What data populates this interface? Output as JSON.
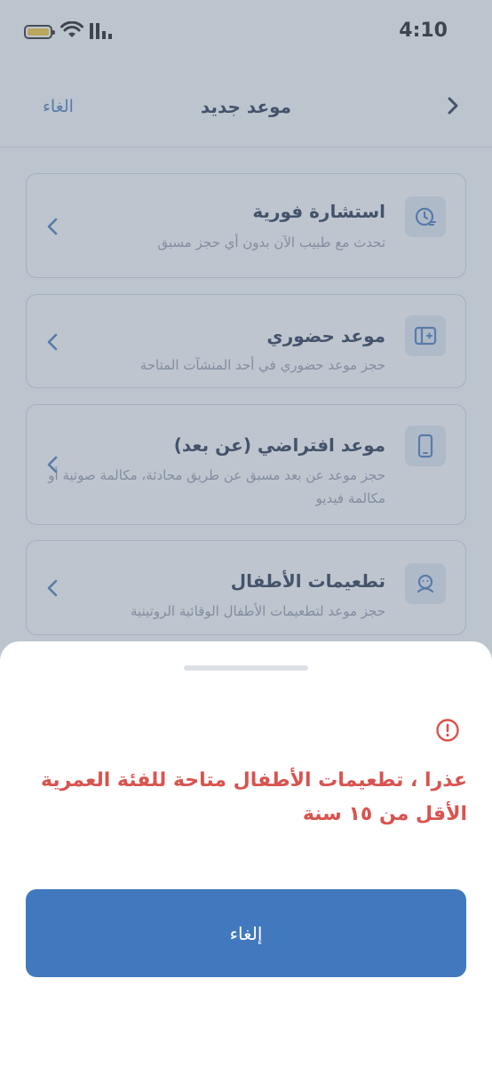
{
  "status_bar": {
    "time": "4:10"
  },
  "header": {
    "title": "موعد جديد",
    "cancel_label": "الغاء"
  },
  "options": [
    {
      "title": "استشارة فورية",
      "description": "تحدث مع طبيب الآن بدون أي حجز مسبق",
      "icon": "instant-consult-icon"
    },
    {
      "title": "موعد حضوري",
      "description": "حجز موعد حضوري في أحد المنشآت المتاحة",
      "icon": "clinic-icon"
    },
    {
      "title": "موعد افتراضي (عن بعد)",
      "description": "حجز موعد عن بعد مسبق عن طريق محادثة، مكالمة صوتية أو مكالمة فيديو",
      "icon": "phone-icon"
    },
    {
      "title": "تطعيمات الأطفال",
      "description": "حجز موعد لتطعيمات الأطفال الوقائية الروتينية",
      "icon": "child-vaccine-icon"
    }
  ],
  "sheet": {
    "message": "عذرا ، تطعيمات الأطفال متاحة للفئة العمرية الأقل من ١٥ سنة",
    "button_label": "إلغاء"
  },
  "colors": {
    "primary": "#4279be",
    "error": "#d9534f",
    "title": "#1b2b48",
    "battery": "#f2c12e"
  }
}
